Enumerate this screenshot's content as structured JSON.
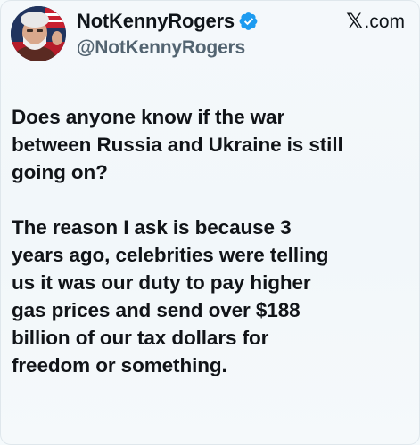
{
  "post": {
    "display_name": "NotKennyRogers",
    "handle": "@NotKennyRogers",
    "verified_icon": "verified-badge-icon",
    "site_label": ".com",
    "site_icon": "x-logo-icon",
    "paragraphs": [
      {
        "lines": [
          "Does anyone know if the war",
          "between Russia and Ukraine is still",
          "going on?"
        ]
      },
      {
        "lines": [
          "The reason I ask is because 3",
          "years ago, celebrities were telling",
          "us it was our duty to pay higher",
          "gas prices and send over $188",
          "billion of our tax dollars for",
          "freedom or something."
        ]
      }
    ]
  },
  "colors": {
    "background": "#f4f8fb",
    "verified_blue": "#1d9bf0",
    "handle_gray": "#536471",
    "text": "#111418"
  }
}
